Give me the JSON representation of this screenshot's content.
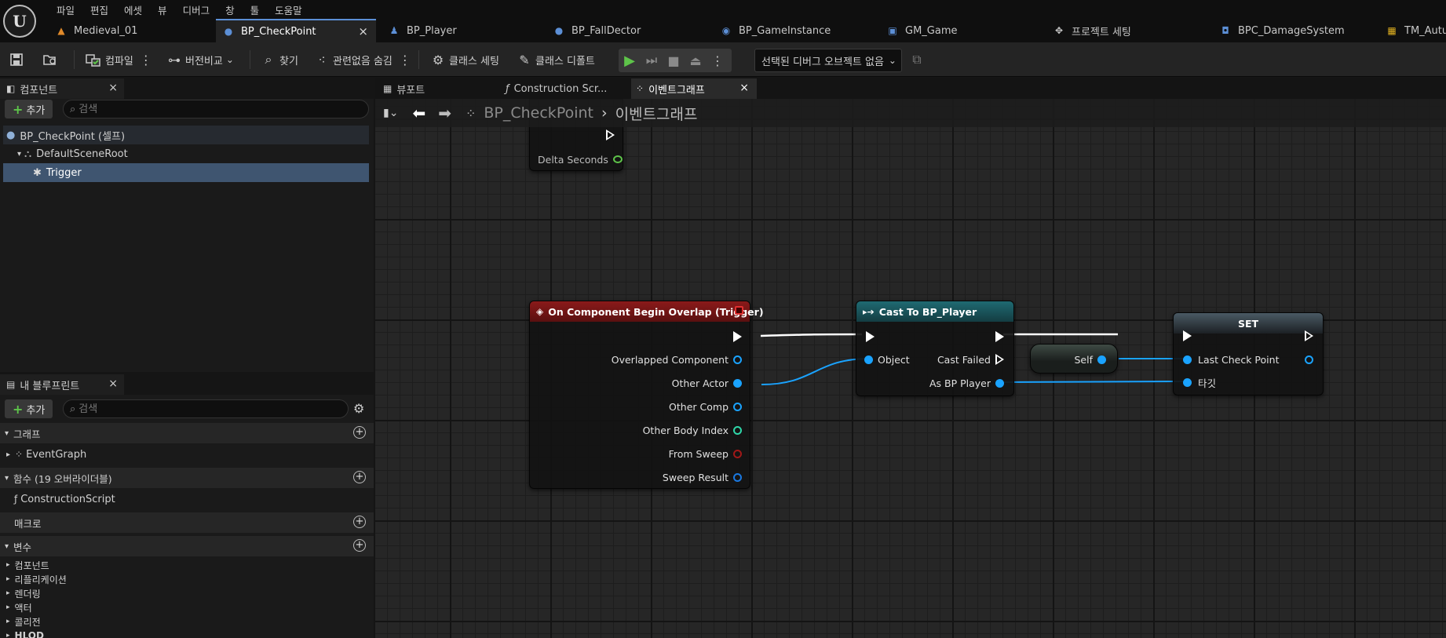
{
  "app": {
    "logo": "U"
  },
  "menu": [
    "파일",
    "편집",
    "에셋",
    "뷰",
    "디버그",
    "창",
    "툴",
    "도움말"
  ],
  "tabs": [
    {
      "label": "Medieval_01",
      "icon": "level-icon",
      "glyph": "▲",
      "color": "#e08a2a"
    },
    {
      "label": "BP_CheckPoint",
      "icon": "blueprint-actor-icon",
      "glyph": "●",
      "color": "#5c8fd6"
    },
    {
      "label": "BP_Player",
      "icon": "character-icon",
      "glyph": "♟",
      "color": "#5c8fd6"
    },
    {
      "label": "BP_FallDector",
      "icon": "blueprint-actor-icon",
      "glyph": "●",
      "color": "#5c8fd6"
    },
    {
      "label": "BP_GameInstance",
      "icon": "game-instance-icon",
      "glyph": "◉",
      "color": "#5c8fd6"
    },
    {
      "label": "GM_Game",
      "icon": "game-mode-icon",
      "glyph": "▣",
      "color": "#5c8fd6"
    },
    {
      "label": "프로젝트 세팅",
      "icon": "settings-icon",
      "glyph": "✥",
      "color": "#c8c8c8"
    },
    {
      "label": "BPC_DamageSystem",
      "icon": "component-icon",
      "glyph": "◘",
      "color": "#5c8fd6"
    },
    {
      "label": "TM_Autu",
      "icon": "grid-icon",
      "glyph": "▦",
      "color": "#e0b020"
    }
  ],
  "tab_close": "×",
  "toolbar": {
    "compile": "컴파일",
    "diff": "버전비교",
    "find": "찾기",
    "hide_unrelated": "관련없음 숨김",
    "class_settings": "클래스 세팅",
    "class_defaults": "클래스 디폴트",
    "debug_object": "선택된 디버그 오브젝트 없음"
  },
  "components_panel": {
    "title": "컴포넌트",
    "add": "추가",
    "search_placeholder": "검색",
    "tree": [
      "BP_CheckPoint (셀프)",
      "DefaultSceneRoot",
      "Trigger"
    ]
  },
  "my_blueprint": {
    "title": "내 블루프린트",
    "add": "추가",
    "search_placeholder": "검색",
    "graph_section": "그래프",
    "event_graph": "EventGraph",
    "functions_section": "함수 (19 오버라이더블)",
    "construction_script": "ConstructionScript",
    "macros_section": "매크로",
    "variables_section": "변수",
    "variable_categories": [
      "컴포넌트",
      "리플리케이션",
      "렌더링",
      "액터",
      "콜리전",
      "HLOD"
    ]
  },
  "graph_tabs": [
    "뷰포트",
    "Construction Scr...",
    "이벤트그래프"
  ],
  "breadcrumb": {
    "root": "BP_CheckPoint",
    "sep": "›",
    "current": "이벤트그래프"
  },
  "nodes": {
    "tick": {
      "pin": "Delta Seconds"
    },
    "overlap": {
      "title": "On Component Begin Overlap (Trigger)",
      "pins": [
        "Overlapped Component",
        "Other Actor",
        "Other Comp",
        "Other Body Index",
        "From Sweep",
        "Sweep Result"
      ]
    },
    "cast": {
      "title": "Cast To BP_Player",
      "object": "Object",
      "failed": "Cast Failed",
      "as": "As BP Player"
    },
    "self": {
      "label": "Self"
    },
    "set": {
      "title": "SET",
      "var": "Last Check Point",
      "target": "타깃"
    }
  },
  "colors": {
    "object_pin": "#1aa3ff",
    "int_pin": "#2fd6a8",
    "bool_pin": "#a01818",
    "struct_pin": "#1a78e0",
    "event_header": "#8b1a1a",
    "cast_header": "#1f5e66",
    "set_header": "#3d4a52",
    "play": "#5ec44a"
  }
}
